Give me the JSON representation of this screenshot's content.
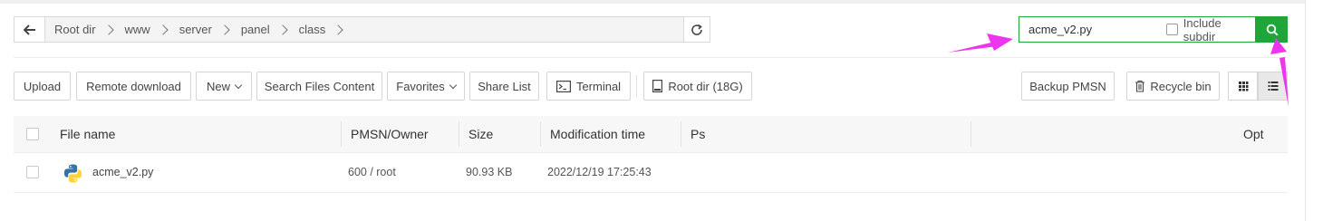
{
  "path": {
    "crumbs": [
      "Root dir",
      "www",
      "server",
      "panel",
      "class"
    ],
    "back_icon": "arrow-left-icon",
    "refresh_icon": "refresh-icon"
  },
  "search": {
    "value": "acme_v2.py",
    "include_subdir_label": "Include subdir",
    "include_subdir_checked": false,
    "button_icon": "search-icon",
    "accent_color": "#20a53a"
  },
  "toolbar": {
    "upload": "Upload",
    "remote_download": "Remote download",
    "new": "New",
    "search_files_content": "Search Files Content",
    "favorites": "Favorites",
    "share_list": "Share List",
    "terminal": "Terminal",
    "root_dir": "Root dir (18G)",
    "backup_pmsn": "Backup PMSN",
    "recycle_bin": "Recycle bin",
    "view_grid_icon": "grid-view-icon",
    "view_list_icon": "list-view-icon"
  },
  "table": {
    "headers": {
      "file_name": "File name",
      "pmsn_owner": "PMSN/Owner",
      "size": "Size",
      "modification_time": "Modification time",
      "ps": "Ps",
      "opt": "Opt"
    },
    "rows": [
      {
        "file_name": "acme_v2.py",
        "icon": "python-file-icon",
        "pmsn_owner": "600 / root",
        "size": "90.93 KB",
        "modification_time": "2022/12/19 17:25:43",
        "ps": ""
      }
    ]
  },
  "annotation_color": "#ee35ee"
}
